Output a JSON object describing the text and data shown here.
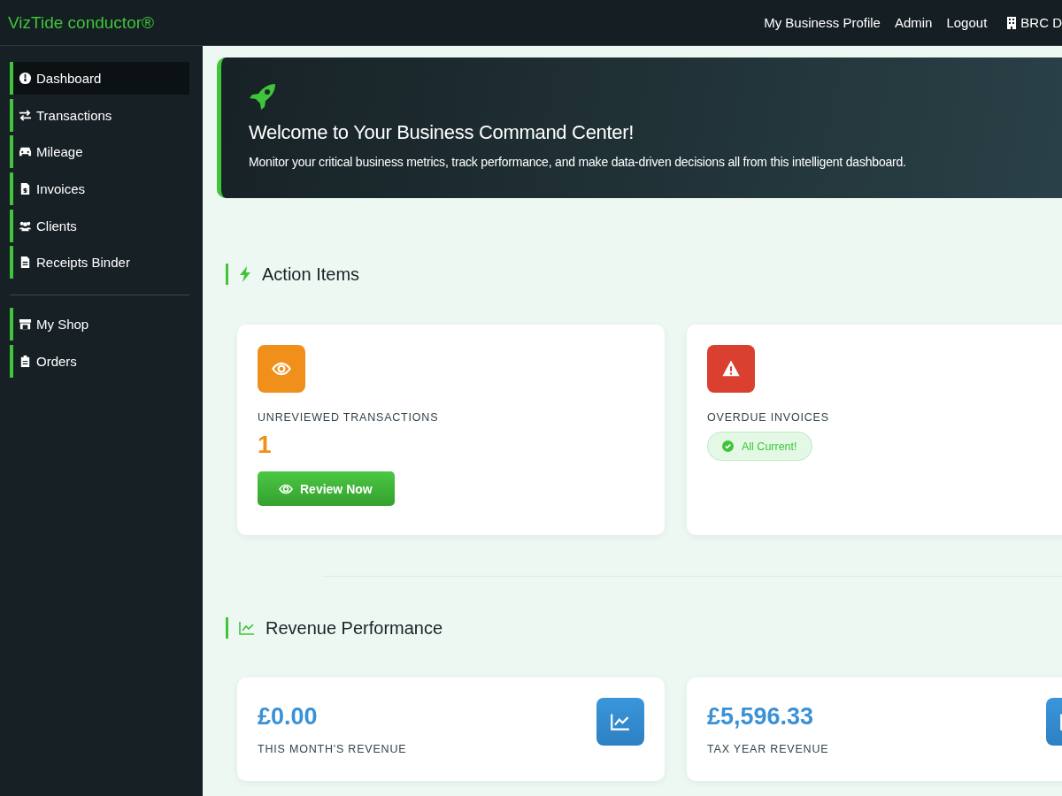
{
  "topbar": {
    "brand": "VizTide conductor®",
    "links": [
      "My Business Profile",
      "Admin",
      "Logout"
    ],
    "account": "BRC D"
  },
  "sidebar": {
    "groups": [
      {
        "items": [
          {
            "label": "Dashboard",
            "selected": true
          },
          {
            "label": "Transactions",
            "selected": false
          },
          {
            "label": "Mileage",
            "selected": false
          },
          {
            "label": "Invoices",
            "selected": false
          },
          {
            "label": "Clients",
            "selected": false
          },
          {
            "label": "Receipts Binder",
            "selected": false
          }
        ]
      },
      {
        "items": [
          {
            "label": "My Shop",
            "selected": false
          },
          {
            "label": "Orders",
            "selected": false
          }
        ]
      }
    ]
  },
  "hero": {
    "title": "Welcome to Your Business Command Center!",
    "text": "Monitor your critical business metrics, track performance, and make data-driven decisions all from this intelligent dashboard."
  },
  "action_items": {
    "heading": "Action Items",
    "cards": [
      {
        "kind": "count",
        "color": "#f0901a",
        "label": "UNREVIEWED TRANSACTIONS",
        "value": "1",
        "button": "Review Now"
      },
      {
        "kind": "status",
        "color": "#d9402f",
        "label": "OVERDUE INVOICES",
        "status": "All Current!"
      }
    ]
  },
  "revenue": {
    "heading": "Revenue Performance",
    "cards": [
      {
        "value": "£0.00",
        "label": "THIS MONTH'S REVENUE"
      },
      {
        "value": "£5,596.33",
        "label": "TAX YEAR REVENUE"
      }
    ]
  }
}
